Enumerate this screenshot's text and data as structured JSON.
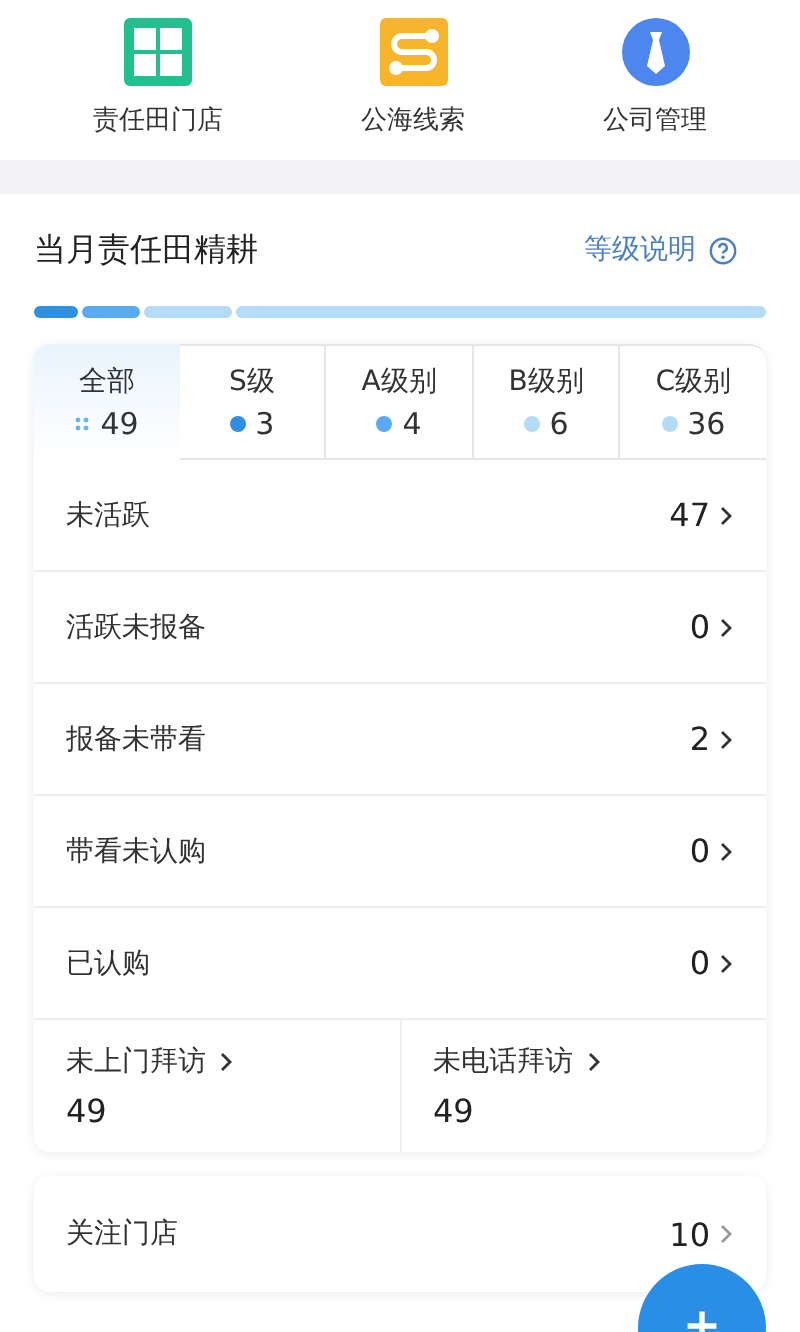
{
  "shortcuts": [
    {
      "label": "责任田门店",
      "kind": "grid"
    },
    {
      "label": "公海线索",
      "kind": "route"
    },
    {
      "label": "公司管理",
      "kind": "tie"
    }
  ],
  "section": {
    "title": "当月责任田精耕",
    "help_link": "等级说明"
  },
  "progress": [
    {
      "color": "#2f8fe0",
      "level": 0.061
    },
    {
      "color": "#5aaaf0",
      "level": 0.082
    },
    {
      "color": "#b4dcf7",
      "level": 0.122
    },
    {
      "color": "#b4dcf7",
      "level": 0.735
    }
  ],
  "tabs": [
    {
      "label": "全部",
      "count": "49",
      "selected": true,
      "kind": "all"
    },
    {
      "label": "S级",
      "count": "3",
      "selected": false,
      "kind": "dot",
      "color": "#2f8fe0"
    },
    {
      "label": "A级别",
      "count": "4",
      "selected": false,
      "kind": "dot",
      "color": "#5aaaf0"
    },
    {
      "label": "B级别",
      "count": "6",
      "selected": false,
      "kind": "dot",
      "color": "#b4dcf7"
    },
    {
      "label": "C级别",
      "count": "36",
      "selected": false,
      "kind": "dot",
      "color": "#b4dcf7"
    }
  ],
  "rows": [
    {
      "label": "未活跃",
      "value": "47"
    },
    {
      "label": "活跃未报备",
      "value": "0"
    },
    {
      "label": "报备未带看",
      "value": "2"
    },
    {
      "label": "带看未认购",
      "value": "0"
    },
    {
      "label": "已认购",
      "value": "0"
    }
  ],
  "visits": [
    {
      "label": "未上门拜访",
      "value": "49"
    },
    {
      "label": "未电话拜访",
      "value": "49"
    }
  ],
  "followed": {
    "label": "关注门店",
    "value": "10"
  }
}
